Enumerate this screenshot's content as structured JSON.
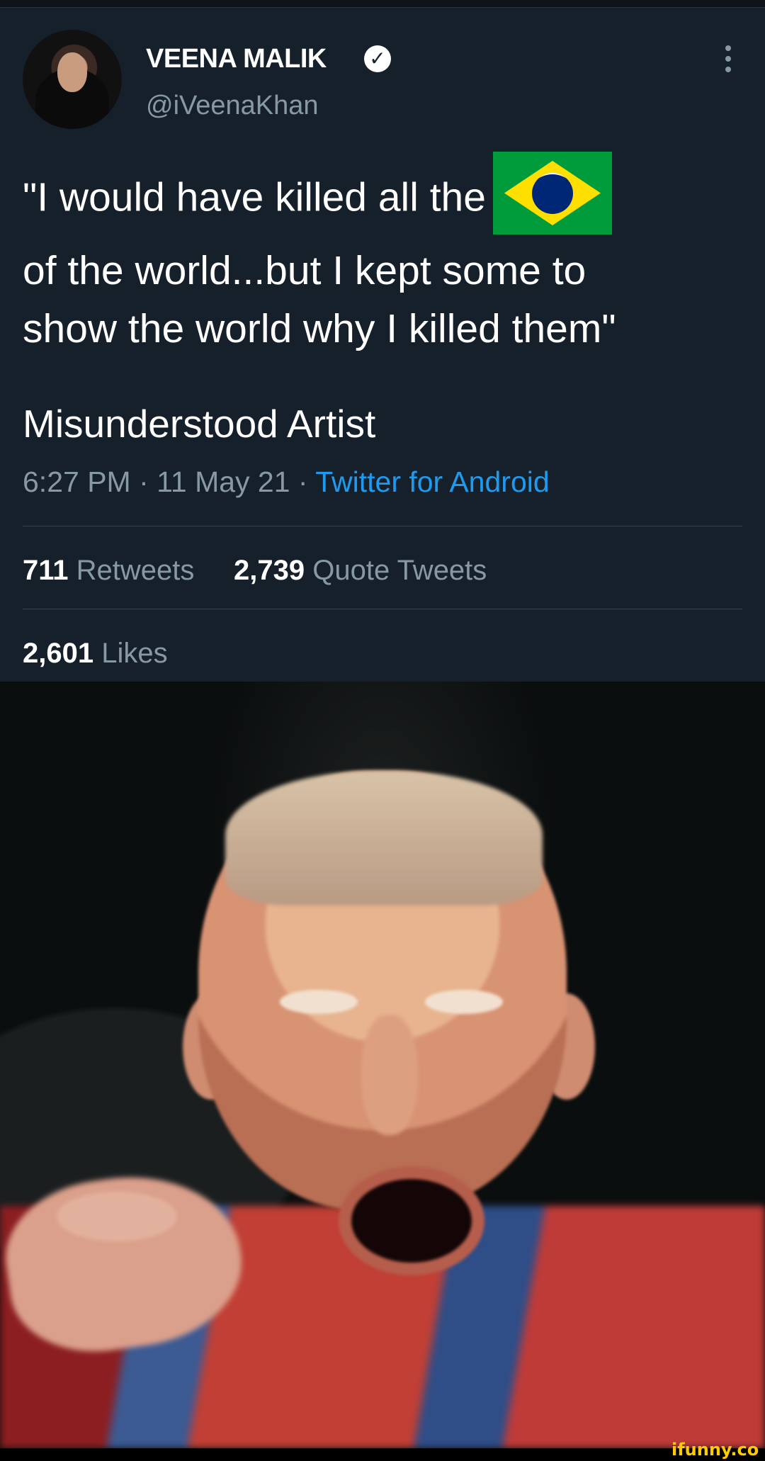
{
  "tweet": {
    "name": "VEENA MALIK",
    "handle": "@iVeenaKhan",
    "text_line_1": "\"I would have killed all the",
    "text_line_2": "of the world...but I kept some to",
    "text_line_3": "show the world why I killed them\"",
    "caption": "Misunderstood Artist",
    "time": "6:27 PM · 11 May 21 ·",
    "source": "Twitter for Android",
    "retweets": "711",
    "retweets_label": "Retweets",
    "quote_tweets": "2,739",
    "quote_tweets_label": "Quote Tweets",
    "likes": "2,601",
    "likes_label": "Likes",
    "verified_icon": "verified-check-icon",
    "more_icon": "vertical-more-icon",
    "flag_icon": "brazil-flag-icon"
  },
  "colors": {
    "background": "#15202b",
    "muted": "#8899a6",
    "link": "#1d9bf0"
  },
  "watermark": "ifunny.co"
}
